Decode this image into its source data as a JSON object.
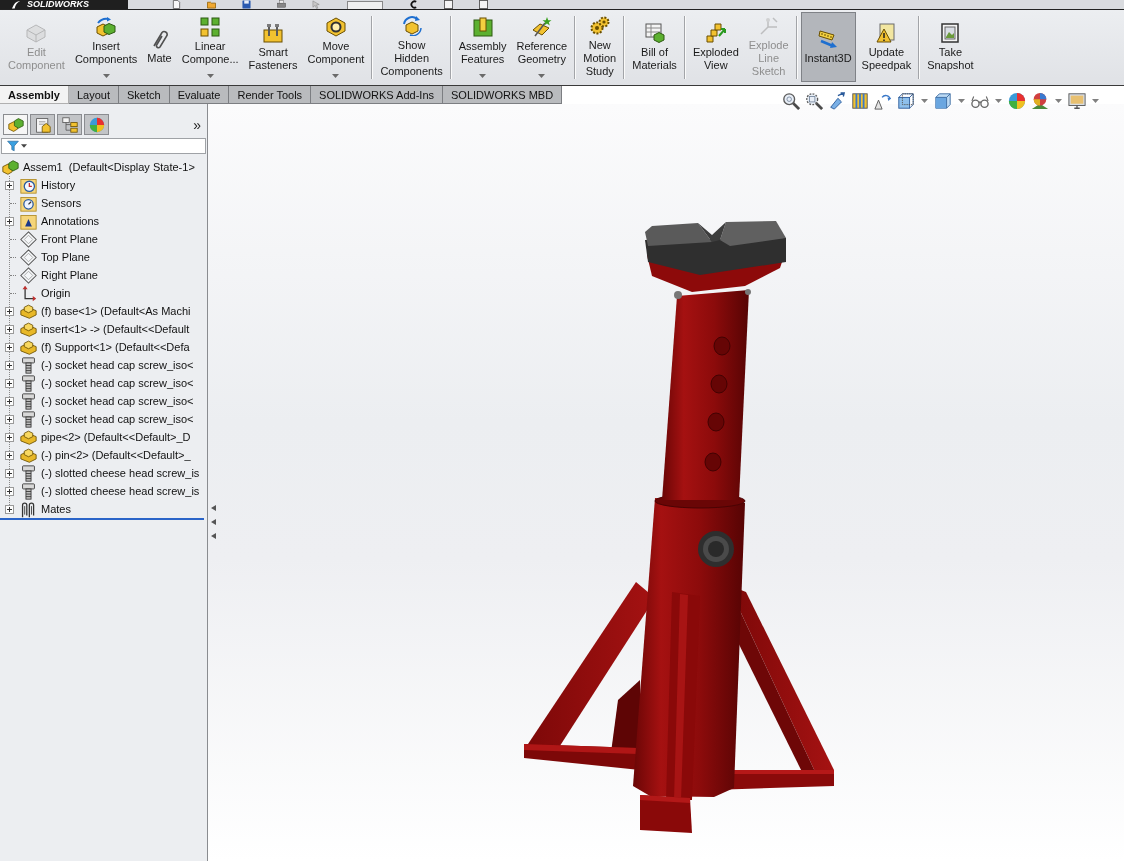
{
  "title_bar": {
    "logo_text": "SOLIDWORKS"
  },
  "command_manager": {
    "groups": [
      [
        {
          "label": "Edit\nComponent",
          "disabled": true,
          "selected": false,
          "dropdown": false
        },
        {
          "label": "Insert\nComponents",
          "disabled": false,
          "selected": false,
          "dropdown": true
        },
        {
          "label": "Mate",
          "disabled": false,
          "selected": false,
          "dropdown": false
        },
        {
          "label": "Linear\nCompone...",
          "disabled": false,
          "selected": false,
          "dropdown": true
        },
        {
          "label": "Smart\nFasteners",
          "disabled": false,
          "selected": false,
          "dropdown": false
        },
        {
          "label": "Move\nComponent",
          "disabled": false,
          "selected": false,
          "dropdown": true
        }
      ],
      [
        {
          "label": "Show\nHidden\nComponents",
          "disabled": false,
          "selected": false,
          "dropdown": false
        }
      ],
      [
        {
          "label": "Assembly\nFeatures",
          "disabled": false,
          "selected": false,
          "dropdown": true
        },
        {
          "label": "Reference\nGeometry",
          "disabled": false,
          "selected": false,
          "dropdown": true
        }
      ],
      [
        {
          "label": "New\nMotion\nStudy",
          "disabled": false,
          "selected": false,
          "dropdown": false
        }
      ],
      [
        {
          "label": "Bill of\nMaterials",
          "disabled": false,
          "selected": false,
          "dropdown": false
        }
      ],
      [
        {
          "label": "Exploded\nView",
          "disabled": false,
          "selected": false,
          "dropdown": false
        },
        {
          "label": "Explode\nLine\nSketch",
          "disabled": true,
          "selected": false,
          "dropdown": false
        }
      ],
      [
        {
          "label": "Instant3D",
          "disabled": false,
          "selected": true,
          "dropdown": false
        },
        {
          "label": "Update\nSpeedpak",
          "disabled": false,
          "selected": false,
          "dropdown": false
        }
      ],
      [
        {
          "label": "Take\nSnapshot",
          "disabled": false,
          "selected": false,
          "dropdown": false
        }
      ]
    ]
  },
  "tabs": [
    {
      "label": "Assembly",
      "selected": true
    },
    {
      "label": "Layout",
      "selected": false
    },
    {
      "label": "Sketch",
      "selected": false
    },
    {
      "label": "Evaluate",
      "selected": false
    },
    {
      "label": "Render Tools",
      "selected": false
    },
    {
      "label": "SOLIDWORKS Add-Ins",
      "selected": false
    },
    {
      "label": "SOLIDWORKS MBD",
      "selected": false
    }
  ],
  "feature_manager": {
    "tabs": [
      {
        "selected": true
      },
      {
        "selected": false
      },
      {
        "selected": false
      },
      {
        "selected": false
      }
    ],
    "more_glyph": "»",
    "tree": {
      "label": "Assem1  (Default<Display State-1>",
      "kind": "assembly",
      "children": [
        {
          "label": "History",
          "kind": "history",
          "expanded": false
        },
        {
          "label": "Sensors",
          "kind": "sensors"
        },
        {
          "label": "Annotations",
          "kind": "annotations",
          "expanded": false
        },
        {
          "label": "Front Plane",
          "kind": "plane"
        },
        {
          "label": "Top Plane",
          "kind": "plane"
        },
        {
          "label": "Right Plane",
          "kind": "plane"
        },
        {
          "label": "Origin",
          "kind": "origin"
        },
        {
          "label": "(f) base<1> (Default<As Machi",
          "kind": "part",
          "expanded": false
        },
        {
          "label": "insert<1> -> (Default<<Default",
          "kind": "part",
          "expanded": false
        },
        {
          "label": "(f) Support<1> (Default<<Defa",
          "kind": "part",
          "expanded": false
        },
        {
          "label": "(-) socket head cap screw_iso<",
          "kind": "screw",
          "expanded": false
        },
        {
          "label": "(-) socket head cap screw_iso<",
          "kind": "screw",
          "expanded": false
        },
        {
          "label": "(-) socket head cap screw_iso<",
          "kind": "screw",
          "expanded": false
        },
        {
          "label": "(-) socket head cap screw_iso<",
          "kind": "screw",
          "expanded": false
        },
        {
          "label": "pipe<2> (Default<<Default>_D",
          "kind": "part",
          "expanded": false
        },
        {
          "label": "(-) pin<2> (Default<<Default>_",
          "kind": "part",
          "expanded": false
        },
        {
          "label": "(-) slotted cheese head screw_is",
          "kind": "screw",
          "expanded": false
        },
        {
          "label": "(-) slotted cheese head screw_is",
          "kind": "screw",
          "expanded": false
        },
        {
          "label": "Mates",
          "kind": "mates",
          "expanded": false
        }
      ]
    }
  }
}
